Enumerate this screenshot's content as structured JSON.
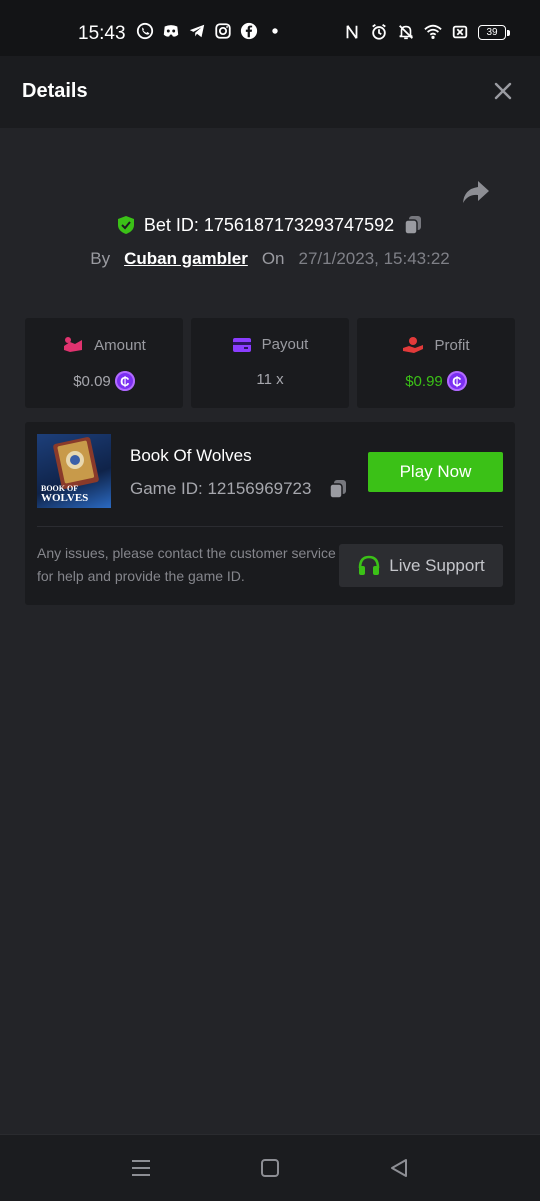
{
  "status_bar": {
    "time": "15:43",
    "left_icons": [
      "whatsapp-icon",
      "discord-icon",
      "telegram-icon",
      "instagram-icon",
      "facebook-icon",
      "dot-icon"
    ],
    "right_icons": [
      "nfc-icon",
      "alarm-icon",
      "mute-icon",
      "wifi-icon",
      "sim-icon"
    ],
    "battery": "39"
  },
  "header": {
    "title": "Details"
  },
  "bet": {
    "id_label": "Bet ID: 1756187173293747592",
    "by_label": "By",
    "user": "Cuban gambler",
    "on_label": "On",
    "date": "27/1/2023, 15:43:22"
  },
  "stats": {
    "amount": {
      "label": "Amount",
      "value": "$0.09",
      "coin": "₵"
    },
    "payout": {
      "label": "Payout",
      "value": "11 x"
    },
    "profit": {
      "label": "Profit",
      "value": "$0.99",
      "coin": "₵"
    }
  },
  "game": {
    "name": "Book Of Wolves",
    "id_label": "Game ID: 12156969723",
    "thumb_text_1": "BOOK OF",
    "thumb_text_2": "WOLVES",
    "play_label": "Play Now",
    "support_text": "Any issues, please contact the customer service for help and provide the game ID.",
    "support_label": "Live Support"
  },
  "colors": {
    "accent_green": "#3bc117",
    "profit_green": "#3bc117",
    "coin_purple": "#7b2ff2",
    "amount_icon": "#e0336f",
    "payout_icon": "#8b3dff",
    "profit_icon": "#e23a3a"
  }
}
